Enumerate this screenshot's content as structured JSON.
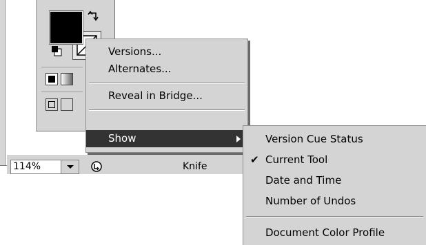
{
  "tools": {
    "fill_color": "#000000",
    "stroke_color": "#e8e8e8"
  },
  "context_menu": {
    "items": [
      {
        "label": "Versions..."
      },
      {
        "label": "Alternates..."
      },
      {
        "label": "Reveal in Bridge..."
      },
      {
        "label": "Show",
        "submenu": true,
        "highlighted": true
      }
    ]
  },
  "submenu": {
    "items": [
      {
        "label": "Version Cue Status",
        "checked": false
      },
      {
        "label": "Current Tool",
        "checked": true
      },
      {
        "label": "Date and Time",
        "checked": false
      },
      {
        "label": "Number of Undos",
        "checked": false
      },
      {
        "label": "Document Color Profile",
        "checked": false
      }
    ],
    "checkmark": "✔"
  },
  "status_bar": {
    "zoom_value": "114%",
    "current_tool": "Knife"
  },
  "colors": {
    "menu_bg": "#d4d4d4",
    "highlight": "#333333"
  }
}
